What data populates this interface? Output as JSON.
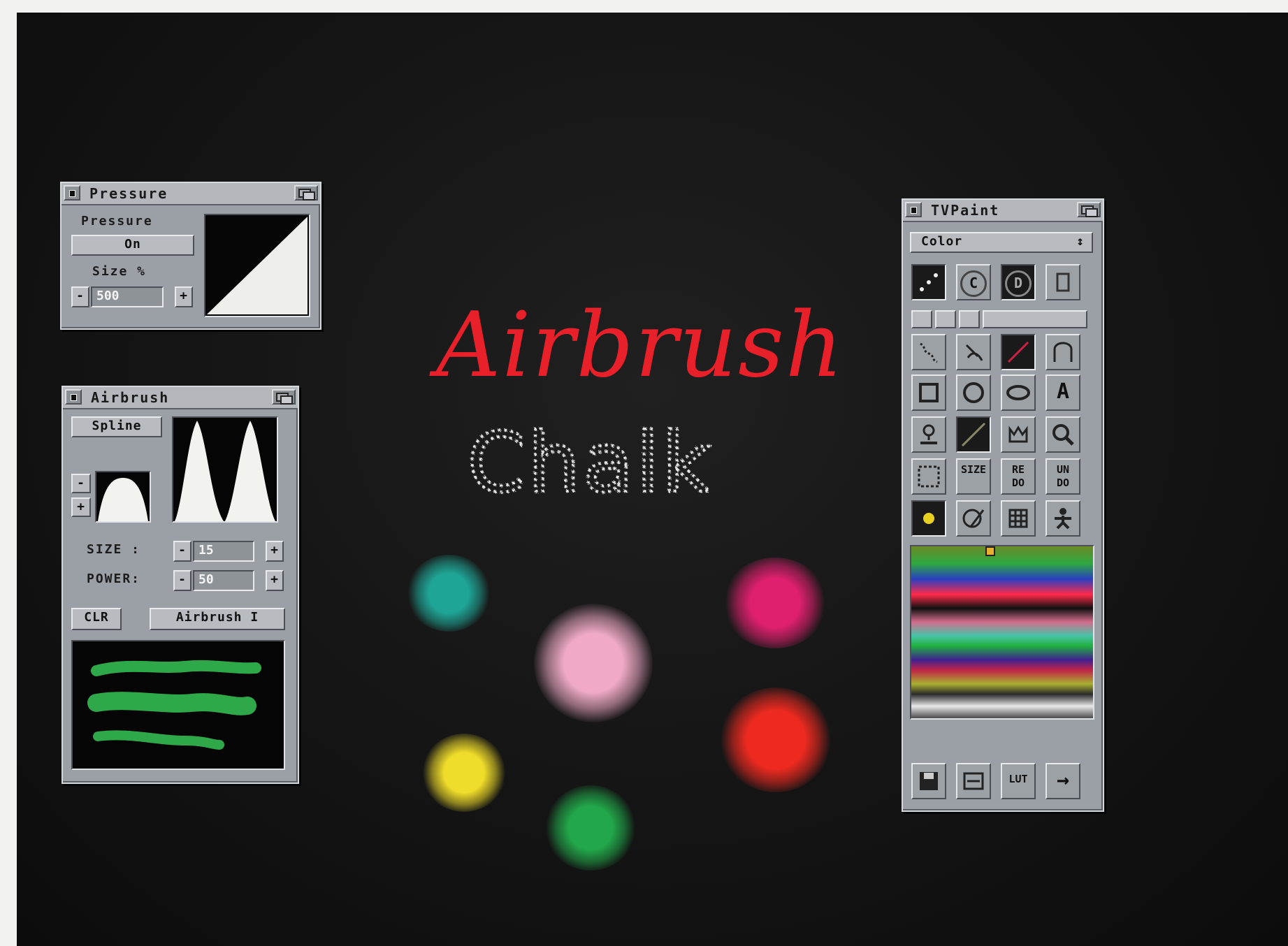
{
  "pressure_window": {
    "title": "Pressure",
    "pressure_label": "Pressure",
    "pressure_button": "On",
    "size_label": "Size %",
    "size_value": "500",
    "minus_glyph": "-",
    "plus_glyph": "+"
  },
  "airbrush_window": {
    "title": "Airbrush",
    "spline_button": "Spline",
    "minus_glyph": "-",
    "plus_glyph": "+",
    "size_label": "SIZE :",
    "size_value": "15",
    "power_label": "POWER:",
    "power_value": "50",
    "clr_button": "CLR",
    "mode_button": "Airbrush I"
  },
  "tvpaint_window": {
    "title": "TVPaint",
    "mode_select": "Color",
    "select_glyph": "↕",
    "tools": {
      "circle_c": "C",
      "circle_d": "D",
      "text_tool": "A",
      "size_label": "SIZE",
      "redo_label": "RE DO",
      "undo_label": "UN DO",
      "lut_label": "LUT",
      "next_arrow": "→"
    },
    "icons": [
      "dots-icon",
      "copyright-icon",
      "d-icon",
      "bracket-icon",
      "freehand-icon",
      "fill-icon",
      "line-icon",
      "curve-icon",
      "rectangle-icon",
      "circle-icon",
      "ellipse-icon",
      "text-icon",
      "stamp-icon",
      "gradient-icon",
      "crown-icon",
      "magnifier-icon",
      "marquee-icon",
      "size-icon",
      "redo-icon",
      "undo-icon",
      "brush-dot-icon",
      "palette-icon",
      "grid-icon",
      "figure-icon",
      "disk-icon",
      "swap-icon",
      "lut-icon",
      "arrow-right-icon"
    ]
  },
  "canvas": {
    "airbrush_text": "Airbrush",
    "chalk_text": "Chalk"
  },
  "colors": {
    "screen_bg": "#141414",
    "window_grey": "#9aa0a6",
    "airbrush_red": "#e8202a",
    "chalk_white": "#e8e8e8",
    "stroke_green": "#2fa84a",
    "blob_teal": "#1fa596",
    "blob_magenta": "#e0206e",
    "blob_pink": "#f0aac8",
    "blob_red": "#ee2a20",
    "blob_yellow": "#f0dc2a",
    "blob_green": "#22a84a"
  }
}
